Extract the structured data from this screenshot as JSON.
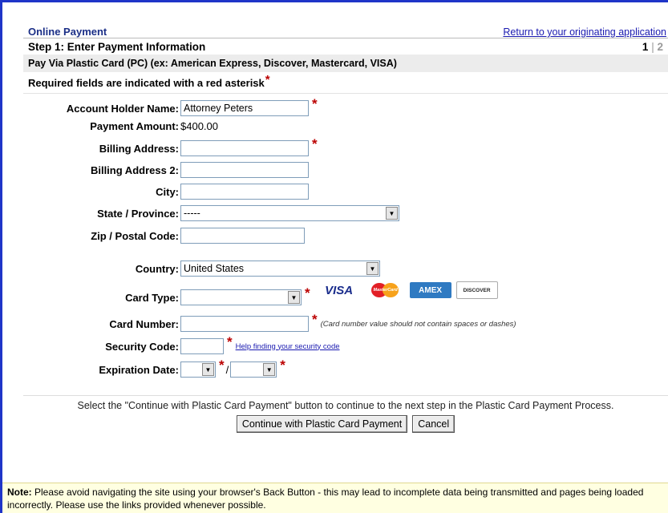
{
  "header": {
    "title": "Online Payment",
    "return_link": "Return to your originating application",
    "step_title": "Step 1: Enter Payment Information",
    "step_current": "1",
    "step_sep": "|",
    "step_next": "2",
    "pay_via": "Pay Via Plastic Card (PC) (ex: American Express, Discover, Mastercard, VISA)",
    "required_note": "Required fields are indicated with a red asterisk",
    "asterisk": "*"
  },
  "form": {
    "account_holder_label": "Account Holder Name:",
    "account_holder_value": "Attorney Peters",
    "payment_amount_label": "Payment Amount:",
    "payment_amount_value": "$400.00",
    "billing_address_label": "Billing Address:",
    "billing_address_value": "",
    "billing_address2_label": "Billing Address 2:",
    "billing_address2_value": "",
    "city_label": "City:",
    "city_value": "",
    "state_label": "State / Province:",
    "state_value": "-----",
    "zip_label": "Zip / Postal Code:",
    "zip_value": "",
    "country_label": "Country:",
    "country_value": "United States",
    "card_type_label": "Card Type:",
    "card_type_value": "",
    "card_number_label": "Card Number:",
    "card_number_value": "",
    "card_number_hint": "(Card number value should not contain spaces or dashes)",
    "security_code_label": "Security Code:",
    "security_code_value": "",
    "security_help_link": "Help finding your security code",
    "expiration_label": "Expiration Date:",
    "expiration_month": "",
    "expiration_year": "",
    "expiration_sep": "/"
  },
  "card_logos": {
    "visa": "VISA",
    "mastercard": "MasterCard",
    "amex": "AMEX",
    "discover": "DISCOVER"
  },
  "footer": {
    "message": "Select the \"Continue with Plastic Card Payment\" button to continue to the next step in the Plastic Card Payment Process.",
    "continue_button": "Continue with Plastic Card Payment",
    "cancel_button": "Cancel"
  },
  "note": {
    "label": "Note:",
    "text": " Please avoid navigating the site using your browser's Back Button - this may lead to incomplete data being transmitted and pages being loaded incorrectly. Please use the links provided whenever possible."
  },
  "colors": {
    "frame_border": "#1f35c8",
    "title": "#1b2f87",
    "asterisk": "#bb0000",
    "note_bg": "#ffffe1"
  }
}
